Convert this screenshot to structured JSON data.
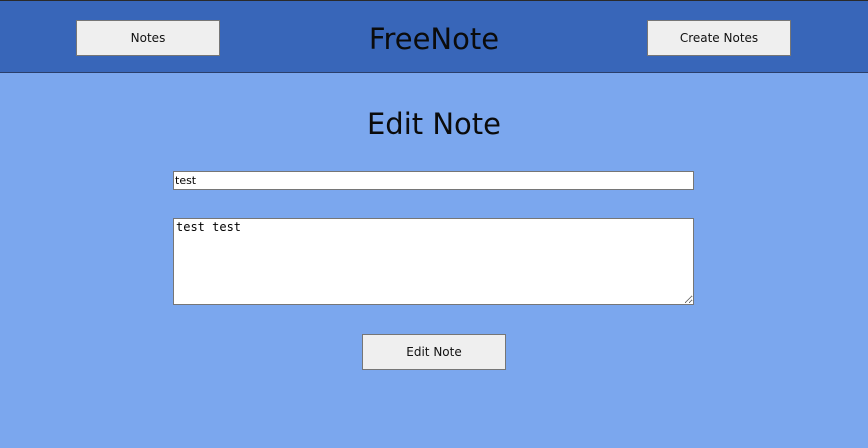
{
  "header": {
    "brand": "FreeNote",
    "notes_button_label": "Notes",
    "create_button_label": "Create Notes",
    "background_color": "#3866b9"
  },
  "main": {
    "title": "Edit Note",
    "title_field_value": "test",
    "body_field_value": "test test",
    "submit_button_label": "Edit Note",
    "background_color": "#7ba7ee"
  }
}
